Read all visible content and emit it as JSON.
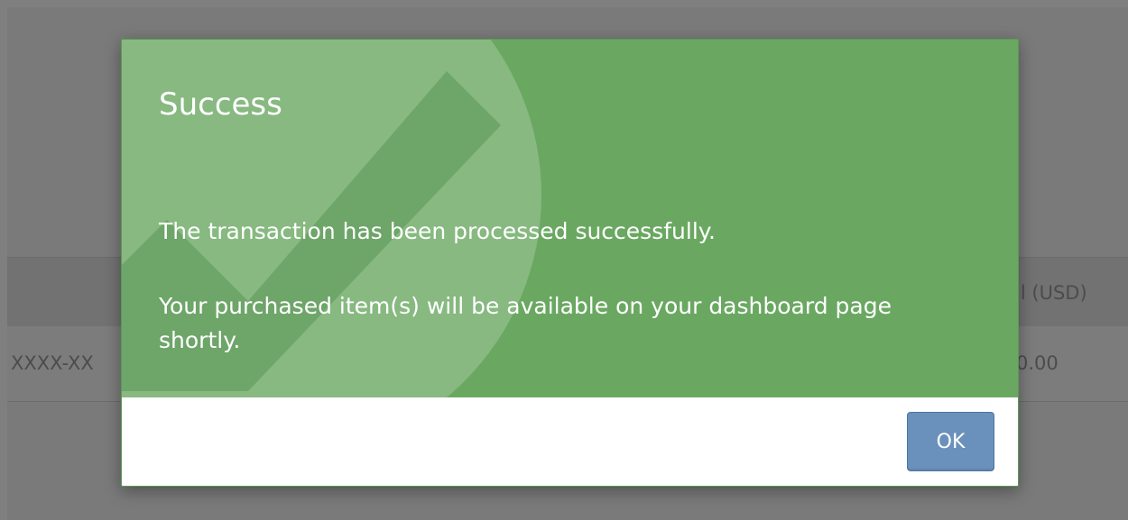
{
  "background": {
    "order_id_partial": "XXXX-XX",
    "total_header_partial": "al (USD)",
    "total_value_partial": "0.00"
  },
  "modal": {
    "title": "Success",
    "message_1": "The transaction has been processed successfully.",
    "message_2": "Your purchased item(s) will be available on your dashboard page shortly.",
    "ok_label": "OK",
    "accent_color": "#6aa862",
    "button_color": "#6a91bb"
  }
}
